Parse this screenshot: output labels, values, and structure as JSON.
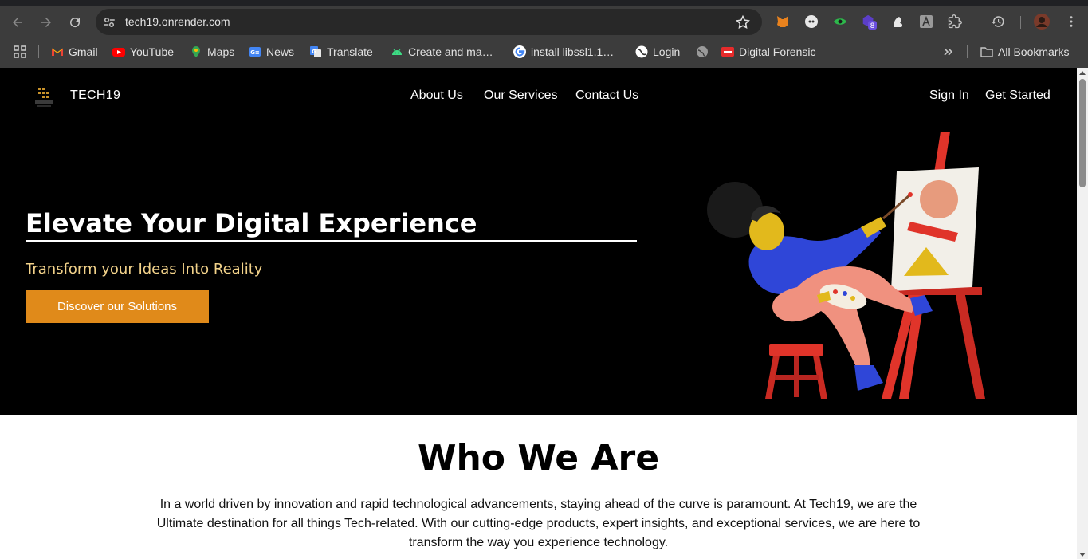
{
  "browser": {
    "url": "tech19.onrender.com",
    "extension_badge": "8",
    "bookmarks": [
      {
        "label": "Gmail",
        "icon": "gmail-icon"
      },
      {
        "label": "YouTube",
        "icon": "youtube-icon"
      },
      {
        "label": "Maps",
        "icon": "maps-icon"
      },
      {
        "label": "News",
        "icon": "news-icon"
      },
      {
        "label": "Translate",
        "icon": "translate-icon"
      },
      {
        "label": "Create and ma…",
        "icon": "android-icon"
      },
      {
        "label": "install libssl1.1…",
        "icon": "google-icon"
      },
      {
        "label": "Login",
        "icon": "login-icon"
      },
      {
        "label": "",
        "icon": "globe-icon"
      },
      {
        "label": "Digital Forensic",
        "icon": "forensic-icon"
      }
    ],
    "all_bookmarks": "All Bookmarks"
  },
  "site": {
    "brand": "TECH19",
    "nav": {
      "about": "About Us",
      "services": "Our Services",
      "contact": "Contact Us",
      "signin": "Sign In",
      "get_started": "Get Started"
    },
    "hero": {
      "title": "Elevate Your Digital Experience",
      "subtitle": "Transform your Ideas Into Reality",
      "cta": "Discover our Solutions"
    },
    "who": {
      "title": "Who We Are",
      "body": "In a world driven by innovation and rapid technological advancements, staying ahead of the curve is paramount. At Tech19, we are the Ultimate destination for all things Tech-related. With our cutting-edge products, expert insights, and exceptional services, we are here to transform the way you experience technology."
    }
  },
  "colors": {
    "hero_bg": "#000000",
    "accent": "#e08a1a",
    "subtitle": "#f2d28a"
  }
}
